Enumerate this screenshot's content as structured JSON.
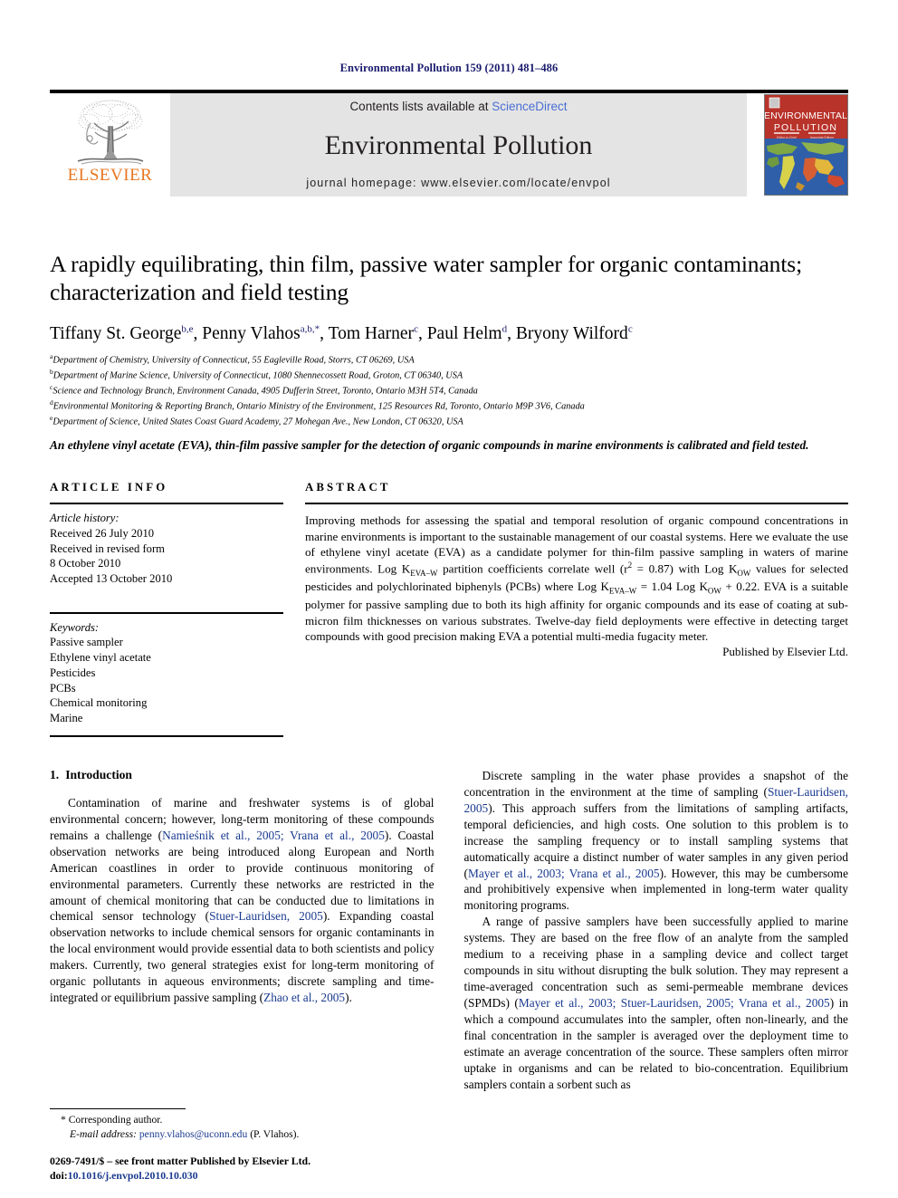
{
  "running_head": "Environmental Pollution 159 (2011) 481–486",
  "masthead": {
    "contents_prefix": "Contents lists available at ",
    "sciencedirect": "ScienceDirect",
    "journal_name": "Environmental Pollution",
    "homepage": "journal homepage: www.elsevier.com/locate/envpol",
    "publisher_word": "ELSEVIER",
    "cover_title_line1": "ENVIRONMENTAL",
    "cover_title_line2": "POLLUTION",
    "accent_orange": "#E87722",
    "link_blue": "#4a6fd4",
    "cite_blue": "#1a3a8f",
    "banner_bg": "#e4e4e4"
  },
  "article": {
    "title": "A rapidly equilibrating, thin film, passive water sampler for organic contaminants; characterization and field testing",
    "authors": [
      {
        "name": "Tiffany St. George",
        "sup": "b,e",
        "sep": ", "
      },
      {
        "name": "Penny Vlahos",
        "sup": "a,b,*",
        "sep": ", "
      },
      {
        "name": "Tom Harner",
        "sup": "c",
        "sep": ", "
      },
      {
        "name": "Paul Helm",
        "sup": "d",
        "sep": ", "
      },
      {
        "name": "Bryony Wilford",
        "sup": "c",
        "sep": ""
      }
    ],
    "affiliations": [
      {
        "mark": "a",
        "text": "Department of Chemistry, University of Connecticut, 55 Eagleville Road, Storrs, CT 06269, USA"
      },
      {
        "mark": "b",
        "text": "Department of Marine Science, University of Connecticut, 1080 Shennecossett Road, Groton, CT 06340, USA"
      },
      {
        "mark": "c",
        "text": "Science and Technology Branch, Environment Canada, 4905 Dufferin Street, Toronto, Ontario M3H 5T4, Canada"
      },
      {
        "mark": "d",
        "text": "Environmental Monitoring & Reporting Branch, Ontario Ministry of the Environment, 125 Resources Rd, Toronto, Ontario M9P 3V6, Canada"
      },
      {
        "mark": "e",
        "text": "Department of Science, United States Coast Guard Academy, 27 Mohegan Ave., New London, CT 06320, USA"
      }
    ],
    "highlight": "An ethylene vinyl acetate (EVA), thin-film passive sampler for the detection of organic compounds in marine environments is calibrated and field tested."
  },
  "article_info": {
    "heading": "ARTICLE INFO",
    "history_label": "Article history:",
    "history": [
      "Received 26 July 2010",
      "Received in revised form",
      "8 October 2010",
      "Accepted 13 October 2010"
    ],
    "keywords_label": "Keywords:",
    "keywords": [
      "Passive sampler",
      "Ethylene vinyl acetate",
      "Pesticides",
      "PCBs",
      "Chemical monitoring",
      "Marine"
    ]
  },
  "abstract": {
    "heading": "ABSTRACT",
    "part1": "Improving methods for assessing the spatial and temporal resolution of organic compound concentrations in marine environments is important to the sustainable management of our coastal systems. Here we evaluate the use of ethylene vinyl acetate (EVA) as a candidate polymer for thin-film passive sampling in waters of marine environments. Log K",
    "sub1": "EVA–W",
    "part2": " partition coefficients correlate well (r",
    "sup1": "2",
    "part3": " = 0.87) with Log K",
    "sub2": "OW",
    "part4": " values for selected pesticides and polychlorinated biphenyls (PCBs) where Log K",
    "sub3": "EVA–W",
    "part5": " = 1.04 Log K",
    "sub4": "OW",
    "part6": " + 0.22. EVA is a suitable polymer for passive sampling due to both its high affinity for organic compounds and its ease of coating at sub-micron film thicknesses on various substrates. Twelve-day field deployments were effective in detecting target compounds with good precision making EVA a potential multi-media fugacity meter.",
    "published_by": "Published by Elsevier Ltd."
  },
  "body": {
    "section_number": "1.",
    "section_title": "Introduction",
    "left_paragraph_1_a": "Contamination of marine and freshwater systems is of global environmental concern; however, long-term monitoring of these compounds remains a challenge (",
    "left_cite_1": "Namieśnik et al., 2005; Vrana et al., 2005",
    "left_paragraph_1_b": "). Coastal observation networks are being introduced along European and North American coastlines in order to provide continuous monitoring of environmental parameters. Currently these networks are restricted in the amount of chemical monitoring that can be conducted due to limitations in chemical sensor technology (",
    "left_cite_2": "Stuer-Lauridsen, 2005",
    "left_paragraph_1_c": "). Expanding coastal observation networks to include chemical sensors for organic contaminants in the local environment would provide essential data to both scientists and policy makers. Currently, two general strategies exist for long-term monitoring of organic pollutants in aqueous environments; discrete sampling and time-integrated or equilibrium passive sampling (",
    "left_cite_3": "Zhao et al., 2005",
    "left_paragraph_1_d": ").",
    "right_paragraph_1_a": "Discrete sampling in the water phase provides a snapshot of the concentration in the environment at the time of sampling (",
    "right_cite_1": "Stuer-Lauridsen, 2005",
    "right_paragraph_1_b": "). This approach suffers from the limitations of sampling artifacts, temporal deficiencies, and high costs. One solution to this problem is to increase the sampling frequency or to install sampling systems that automatically acquire a distinct number of water samples in any given period (",
    "right_cite_2": "Mayer et al., 2003; Vrana et al., 2005",
    "right_paragraph_1_c": "). However, this may be cumbersome and prohibitively expensive when implemented in long-term water quality monitoring programs.",
    "right_paragraph_2_a": "A range of passive samplers have been successfully applied to marine systems. They are based on the free flow of an analyte from the sampled medium to a receiving phase in a sampling device and collect target compounds in situ without disrupting the bulk solution. They may represent a time-averaged concentration such as semi-permeable membrane devices (SPMDs) (",
    "right_cite_3": "Mayer et al., 2003; Stuer-Lauridsen, 2005; Vrana et al., 2005",
    "right_paragraph_2_b": ") in which a compound accumulates into the sampler, often non-linearly, and the final concentration in the sampler is averaged over the deployment time to estimate an average concentration of the source. These samplers often mirror uptake in organisms and can be related to bio-concentration. Equilibrium samplers contain a sorbent such as"
  },
  "footer": {
    "corresponding_marker": "*",
    "corresponding_label": "Corresponding author.",
    "email_label": "E-mail address:",
    "email": "penny.vlahos@uconn.edu",
    "email_owner": "(P. Vlahos).",
    "issn_line": "0269-7491/$ – see front matter Published by Elsevier Ltd.",
    "doi_label": "doi:",
    "doi": "10.1016/j.envpol.2010.10.030"
  }
}
